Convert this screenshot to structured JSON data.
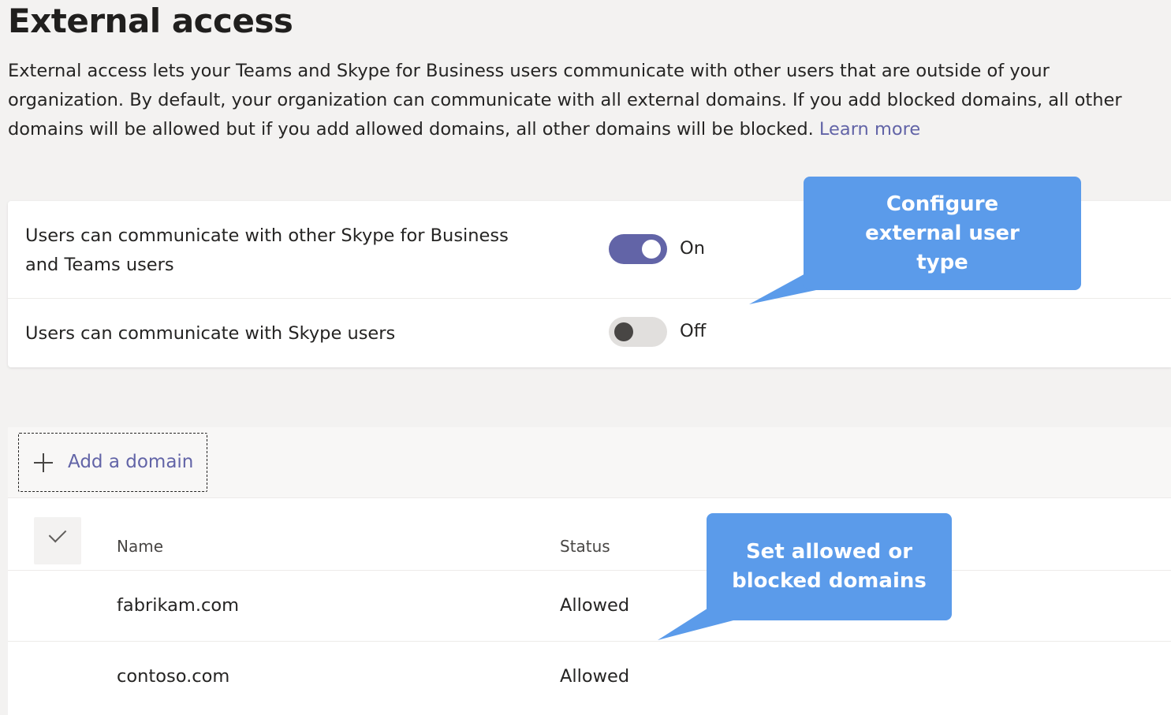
{
  "header": {
    "title": "External access",
    "description": "External access lets your Teams and Skype for Business users communicate with other users that are outside of your organization. By default, your organization can communicate with all external domains. If you add blocked domains, all other domains will be allowed but if you add allowed domains, all other domains will be blocked.",
    "learn_more": "Learn more"
  },
  "settings": [
    {
      "label": "Users can communicate with other Skype for Business and Teams users",
      "enabled": true,
      "state_label": "On"
    },
    {
      "label": "Users can communicate with Skype users",
      "enabled": false,
      "state_label": "Off"
    }
  ],
  "domains": {
    "add_label": "Add a domain",
    "columns": [
      "Name",
      "Status"
    ],
    "rows": [
      {
        "name": "fabrikam.com",
        "status": "Allowed"
      },
      {
        "name": "contoso.com",
        "status": "Allowed"
      }
    ]
  },
  "callouts": {
    "user_type": "Configure external user type",
    "domains": "Set allowed or blocked domains"
  },
  "colors": {
    "accent": "#6264a7",
    "callout": "#5b9bea",
    "background": "#f3f2f1"
  },
  "icons": {
    "add": "plus-icon",
    "select_all": "check-icon"
  }
}
